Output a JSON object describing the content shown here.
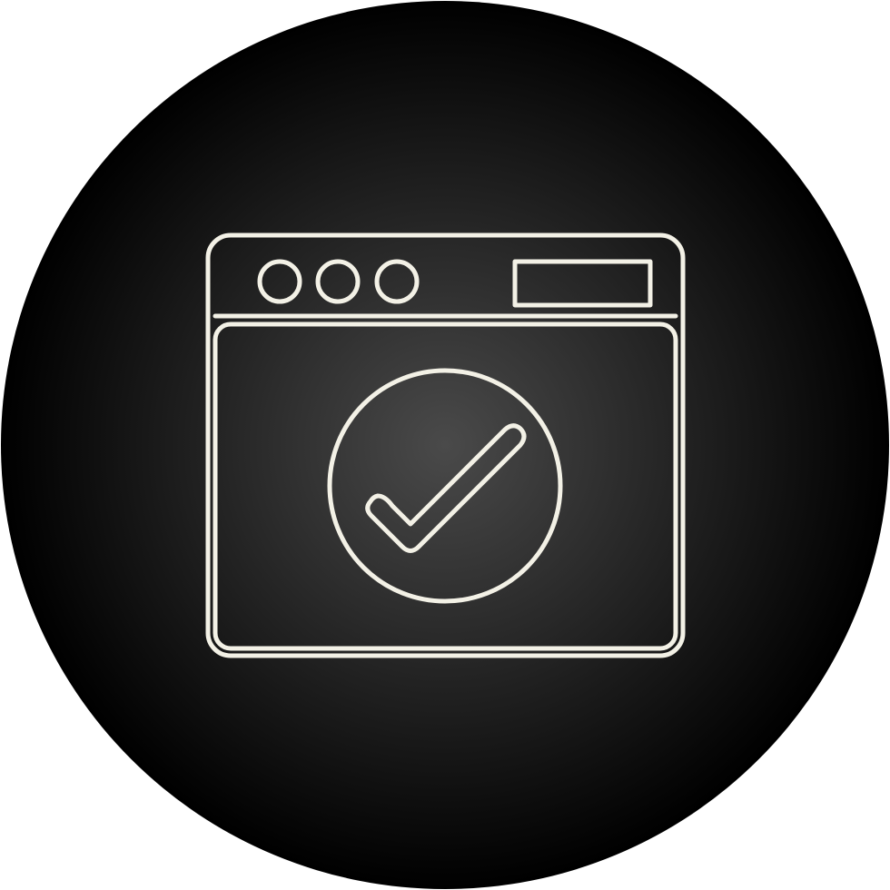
{
  "icon": {
    "name": "browser-window-checkmark-icon",
    "style": "line icon on dark circular badge"
  },
  "colors": {
    "page_background": "#ffffff",
    "badge_center": "#4a4a4a",
    "badge_edge": "#000000",
    "stroke": "#f3f1e6"
  }
}
